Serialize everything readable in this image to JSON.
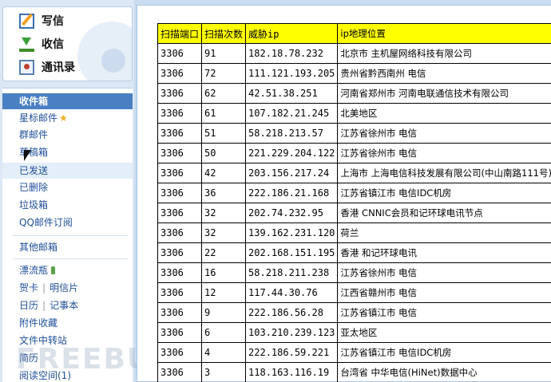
{
  "sidebar": {
    "compose_label": "写信",
    "receive_label": "收信",
    "contacts_label": "通讯录",
    "folders": {
      "inbox": "收件箱",
      "starred": "星标邮件",
      "group": "群邮件",
      "drafts": "草稿箱",
      "sent": "已发送",
      "deleted": "已删除",
      "spam": "垃圾箱",
      "subscriptions": "QQ邮件订阅",
      "other": "其他邮箱"
    },
    "apps": {
      "drift_bottle": "漂流瓶",
      "cards": "贺卡",
      "postcards": "明信片",
      "calendar": "日历",
      "notes": "记事本",
      "attachments": "附件收藏",
      "file_transfer": "文件中转站",
      "resume": "简历",
      "reading_space": "阅读空间(1)"
    },
    "watermark": "FREEBUF"
  },
  "table": {
    "headers": [
      "扫描端口",
      "扫描次数",
      "威胁ip",
      "ip地理位置"
    ],
    "rows": [
      [
        "3306",
        "91",
        "182.18.78.232",
        "北京市 主机屋网络科技有限公司"
      ],
      [
        "3306",
        "72",
        "111.121.193.205",
        "贵州省黔西南州 电信"
      ],
      [
        "3306",
        "62",
        "42.51.38.251",
        "河南省郑州市 河南电联通信技术有限公司"
      ],
      [
        "3306",
        "61",
        "107.182.21.245",
        "北美地区"
      ],
      [
        "3306",
        "51",
        "58.218.213.57",
        "江苏省徐州市 电信"
      ],
      [
        "3306",
        "50",
        "221.229.204.122",
        "江苏省徐州市 电信"
      ],
      [
        "3306",
        "42",
        "203.156.217.24",
        "上海市 上海电信科技发展有限公司(中山南路111号)"
      ],
      [
        "3306",
        "36",
        "222.186.21.168",
        "江苏省镇江市 电信IDC机房"
      ],
      [
        "3306",
        "32",
        "202.74.232.95",
        "香港 CNNIC会员和记环球电讯节点"
      ],
      [
        "3306",
        "32",
        "139.162.231.120",
        "荷兰"
      ],
      [
        "3306",
        "22",
        "202.168.151.195",
        "香港 和记环球电讯"
      ],
      [
        "3306",
        "16",
        "58.218.211.238",
        "江苏省徐州市 电信"
      ],
      [
        "3306",
        "12",
        "117.44.30.76",
        "江西省赣州市 电信"
      ],
      [
        "3306",
        "9",
        "222.186.56.28",
        "江苏省镇江市 电信"
      ],
      [
        "3306",
        "6",
        "103.210.239.123",
        "亚太地区"
      ],
      [
        "3306",
        "4",
        "222.186.59.221",
        "江苏省镇江市 电信IDC机房"
      ],
      [
        "3306",
        "3",
        "118.163.116.19",
        "台湾省 中华电信(HiNet)数据中心"
      ]
    ]
  },
  "colors": {
    "header_bg": "#ffff00",
    "active_folder": "#4a7fc4",
    "link": "#1f4f99"
  }
}
